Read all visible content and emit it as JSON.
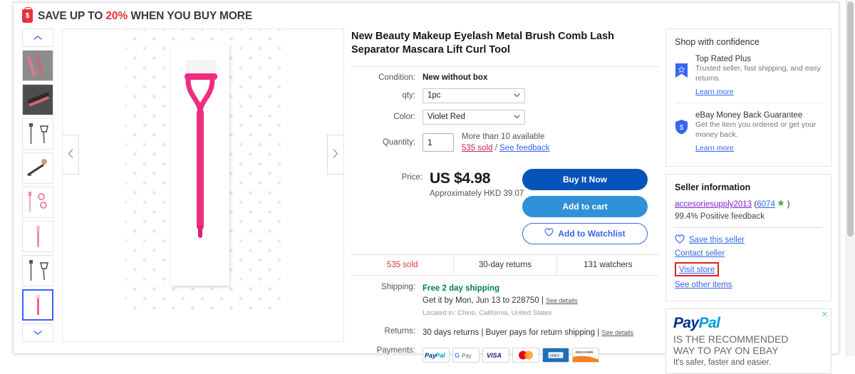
{
  "promo": {
    "icon": "price-tag-icon",
    "prefix": "SAVE UP TO ",
    "percent": "20%",
    "suffix": " WHEN YOU BUY MORE"
  },
  "gallery": {
    "scroll_up": "chevron-up-icon",
    "scroll_down": "chevron-down-icon",
    "prev": "chevron-left-icon",
    "next": "chevron-right-icon",
    "selected_index": 6,
    "thumbnails": [
      {
        "name": "thumb-1-brush-gray"
      },
      {
        "name": "thumb-2-brush-dark"
      },
      {
        "name": "thumb-3-two-tools"
      },
      {
        "name": "thumb-4-angled-brush"
      },
      {
        "name": "thumb-5-pink-parts"
      },
      {
        "name": "thumb-6-pink-handle"
      },
      {
        "name": "thumb-7-two-tools"
      },
      {
        "name": "thumb-8-pink-comb"
      }
    ]
  },
  "item": {
    "title": "New Beauty Makeup Eyelash Metal Brush Comb Lash Separator Mascara Lift Curl Tool",
    "condition_label": "Condition:",
    "condition_value": "New without box",
    "qty_label": "qty:",
    "qty_value": "1pc",
    "color_label": "Color:",
    "color_value": "Violet Red",
    "quantity_label": "Quantity:",
    "quantity_value": "1",
    "availability": "More than 10 available",
    "sold_link": "535 sold",
    "slash": "/",
    "feedback_link": "See feedback"
  },
  "price": {
    "label": "Price:",
    "amount": "US $4.98",
    "approx": "Approximately HKD 39.07"
  },
  "cta": {
    "buy_now": "Buy It Now",
    "add_to_cart": "Add to cart",
    "add_to_watchlist": "Add to Watchlist",
    "heart_icon": "heart-outline-icon"
  },
  "stats": [
    {
      "label": "535 sold",
      "highlight": true
    },
    {
      "label": "30-day returns",
      "highlight": false
    },
    {
      "label": "131 watchers",
      "highlight": false
    }
  ],
  "shipping": {
    "label": "Shipping:",
    "free_text": "Free 2 day shipping",
    "eta": "Get it by Mon, Jun 13 to 228750",
    "pipe": "|",
    "see_details": "See details",
    "located": "Located in: Chino, California, United States"
  },
  "returns": {
    "label": "Returns:",
    "text": "30 days returns | Buyer pays for return shipping |",
    "see_details": "See details"
  },
  "payments": {
    "label": "Payments:",
    "methods": [
      "PayPal",
      "G Pay",
      "VISA",
      "Mastercard",
      "American Express",
      "Discover"
    ]
  },
  "shop_confidence": {
    "title": "Shop with confidence",
    "items": [
      {
        "icon": "top-rated-plus-badge-icon",
        "head": "Top Rated Plus",
        "desc": "Trusted seller, fast shipping, and easy returns.",
        "link": "Learn more"
      },
      {
        "icon": "money-back-shield-icon",
        "head": "eBay Money Back Guarantee",
        "desc": "Get the item you ordered or get your money back.",
        "link": "Learn more"
      }
    ]
  },
  "seller": {
    "title": "Seller information",
    "name": "accesoriesupply2013",
    "score_open": "(",
    "score": "6074",
    "star_icon": "star-icon",
    "score_close": ")",
    "feedback": "99.4% Positive feedback",
    "save_seller": "Save this seller",
    "save_icon": "heart-outline-icon",
    "contact_seller": "Contact seller",
    "visit_store": "Visit store",
    "see_other_items": "See other items"
  },
  "ad": {
    "close_icon": "close-icon",
    "logo_pay": "Pay",
    "logo_pal": "Pal",
    "line1": "IS THE RECOMMENDED",
    "line2": "WAY TO PAY ON EBAY",
    "line3": "It's safer, faster and easier."
  },
  "colors": {
    "ebay_red": "#e53238",
    "ebay_blue": "#0654ba",
    "cart_blue": "#3090d8",
    "link_blue": "#3665f3",
    "green": "#00804a",
    "purple": "#7d26cd",
    "highlight_red": "#e02020"
  }
}
